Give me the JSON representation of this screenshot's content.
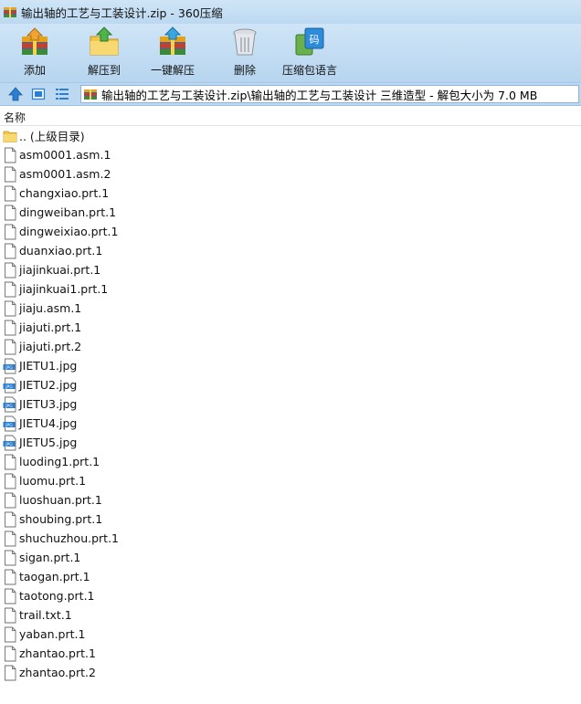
{
  "window": {
    "title": "输出轴的工艺与工装设计.zip - 360压缩"
  },
  "toolbar": {
    "add_label": "添加",
    "extract_to_label": "解压到",
    "one_click_extract_label": "一键解压",
    "delete_label": "删除",
    "encoding_label": "压缩包语言"
  },
  "address": {
    "path": "输出轴的工艺与工装设计.zip\\输出轴的工艺与工装设计 三维造型 - 解包大小为 7.0 MB"
  },
  "columns": {
    "name": "名称"
  },
  "files": [
    {
      "name": ".. (上级目录)",
      "icon": "folder-icon"
    },
    {
      "name": "asm0001.asm.1",
      "icon": "file-icon"
    },
    {
      "name": "asm0001.asm.2",
      "icon": "file-icon"
    },
    {
      "name": "changxiao.prt.1",
      "icon": "file-icon"
    },
    {
      "name": "dingweiban.prt.1",
      "icon": "file-icon"
    },
    {
      "name": "dingweixiao.prt.1",
      "icon": "file-icon"
    },
    {
      "name": "duanxiao.prt.1",
      "icon": "file-icon"
    },
    {
      "name": "jiajinkuai.prt.1",
      "icon": "file-icon"
    },
    {
      "name": "jiajinkuai1.prt.1",
      "icon": "file-icon"
    },
    {
      "name": "jiaju.asm.1",
      "icon": "file-icon"
    },
    {
      "name": "jiajuti.prt.1",
      "icon": "file-icon"
    },
    {
      "name": "jiajuti.prt.2",
      "icon": "file-icon"
    },
    {
      "name": "JIETU1.jpg",
      "icon": "jpg-icon"
    },
    {
      "name": "JIETU2.jpg",
      "icon": "jpg-icon"
    },
    {
      "name": "JIETU3.jpg",
      "icon": "jpg-icon"
    },
    {
      "name": "JIETU4.jpg",
      "icon": "jpg-icon"
    },
    {
      "name": "JIETU5.jpg",
      "icon": "jpg-icon"
    },
    {
      "name": "luoding1.prt.1",
      "icon": "file-icon"
    },
    {
      "name": "luomu.prt.1",
      "icon": "file-icon"
    },
    {
      "name": "luoshuan.prt.1",
      "icon": "file-icon"
    },
    {
      "name": "shoubing.prt.1",
      "icon": "file-icon"
    },
    {
      "name": "shuchuzhou.prt.1",
      "icon": "file-icon"
    },
    {
      "name": "sigan.prt.1",
      "icon": "file-icon"
    },
    {
      "name": "taogan.prt.1",
      "icon": "file-icon"
    },
    {
      "name": "taotong.prt.1",
      "icon": "file-icon"
    },
    {
      "name": "trail.txt.1",
      "icon": "file-icon"
    },
    {
      "name": "yaban.prt.1",
      "icon": "file-icon"
    },
    {
      "name": "zhantao.prt.1",
      "icon": "file-icon"
    },
    {
      "name": "zhantao.prt.2",
      "icon": "file-icon"
    }
  ]
}
